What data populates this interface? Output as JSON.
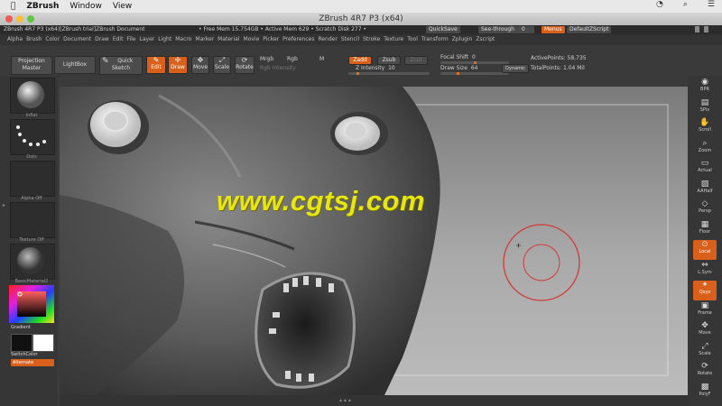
{
  "mac_menu": {
    "app": "ZBrush",
    "items": [
      "Window",
      "View"
    ]
  },
  "window": {
    "title": "ZBrush 4R7 P3 (x64)"
  },
  "status": {
    "left": "ZBrush 4R7 P3 (x64)[ZBrush trial]ZBrush Document",
    "mem": "• Free Mem 15.754GB • Active Mem 629 • Scratch Disk 277 •",
    "quicksave": "QuickSave",
    "seethrough": "See-through",
    "seethrough_value": "0",
    "menus": "Menus",
    "script": "DefaultZScript"
  },
  "menus": [
    "Alpha",
    "Brush",
    "Color",
    "Document",
    "Draw",
    "Edit",
    "File",
    "Layer",
    "Light",
    "Macro",
    "Marker",
    "Material",
    "Movie",
    "Picker",
    "Preferences",
    "Render",
    "Stencil",
    "Stroke",
    "Texture",
    "Tool",
    "Transform",
    "Zplugin",
    "Zscript"
  ],
  "toolbar": {
    "projection_master": "Projection Master",
    "lightbox": "LightBox",
    "quick_sketch": "Quick Sketch",
    "edit": "Edit",
    "draw": "Draw",
    "move": "Move",
    "scale": "Scale",
    "rotate": "Rotate",
    "mrgb": "Mrgb",
    "rgb": "Rgb",
    "m": "M",
    "rgb_intensity": "Rgb Intensity",
    "zadd": "Zadd",
    "zsub": "Zsub",
    "zcut": "Zcut",
    "z_intensity_label": "Z Intensity",
    "z_intensity_value": "10",
    "focal_shift_label": "Focal Shift",
    "focal_shift_value": "0",
    "draw_size_label": "Draw Size",
    "draw_size_value": "64",
    "dynamic": "Dynamic",
    "active_points": "ActivePoints: 58,735",
    "total_points": "TotalPoints: 1.04 Mil",
    "z_intensity_level": 0.1,
    "focal_shift_level": 0.5,
    "draw_size_level": 0.25
  },
  "left_shelf": {
    "brush": "Inflat",
    "stroke": "Dots",
    "alpha": "Alpha Off",
    "texture": "Texture Off",
    "material": "BasicMaterial2",
    "gradient": "Gradient",
    "switch_color": "SwitchColor",
    "alternate": "Alternate"
  },
  "right_shelf": [
    {
      "icon": "bpr-icon",
      "label": "BPR",
      "glyph": "◉"
    },
    {
      "icon": "spix-icon",
      "label": "SPix",
      "glyph": "▤"
    },
    {
      "icon": "scroll-icon",
      "label": "Scroll",
      "glyph": "✋"
    },
    {
      "icon": "zoom-icon",
      "label": "Zoom",
      "glyph": "⌕"
    },
    {
      "icon": "actual-icon",
      "label": "Actual",
      "glyph": "▭"
    },
    {
      "icon": "aahalf-icon",
      "label": "AAHalf",
      "glyph": "▨"
    },
    {
      "icon": "persp-icon",
      "label": "Persp",
      "glyph": "◇"
    },
    {
      "icon": "floor-icon",
      "label": "Floor",
      "glyph": "▦"
    },
    {
      "icon": "local-icon",
      "label": "Local",
      "glyph": "⊙"
    },
    {
      "icon": "lsym-icon",
      "label": "L.Sym",
      "glyph": "⇔"
    },
    {
      "icon": "xyz-icon",
      "label": "Qxyz",
      "glyph": "✦"
    },
    {
      "icon": "frame-icon",
      "label": "Frame",
      "glyph": "▣"
    },
    {
      "icon": "move-icon",
      "label": "Move",
      "glyph": "✥"
    },
    {
      "icon": "scale-icon",
      "label": "Scale",
      "glyph": "⤢"
    },
    {
      "icon": "rotate-icon",
      "label": "Rotate",
      "glyph": "⟳"
    },
    {
      "icon": "polyf-icon",
      "label": "PolyF",
      "glyph": "▩"
    }
  ],
  "watermark": "www.cgtsj.com",
  "colors": {
    "accent": "#d9601a",
    "watermark": "#e8e60c",
    "brush_circle": "#d23a3a"
  }
}
